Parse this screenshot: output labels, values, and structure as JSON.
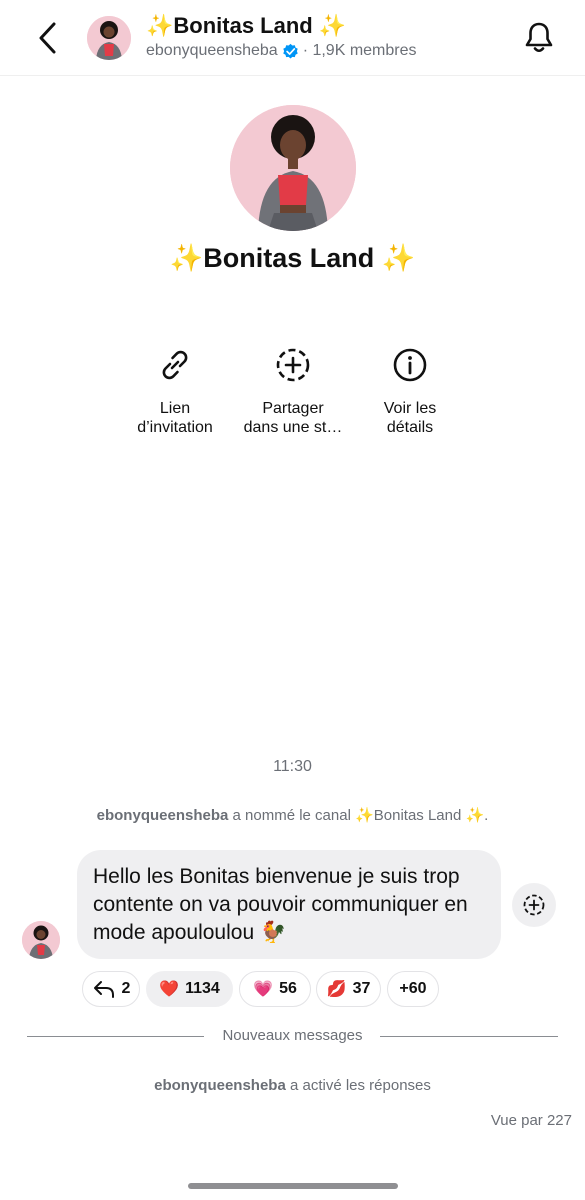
{
  "header": {
    "title": "✨Bonitas Land ✨",
    "owner": "ebonyqueensheba",
    "members": "· 1,9K membres"
  },
  "profile": {
    "name": "✨Bonitas Land ✨"
  },
  "actions": [
    {
      "label": "Lien\nd’invitation",
      "icon": "link-icon"
    },
    {
      "label": "Partager\ndans une st…",
      "icon": "add-story-icon"
    },
    {
      "label": "Voir les\ndétails",
      "icon": "info-icon"
    }
  ],
  "chat": {
    "time": "11:30",
    "system1_user": "ebonyqueensheba",
    "system1_text": " a nommé le canal ✨Bonitas Land ✨.",
    "message": "Hello les Bonitas bienvenue je suis trop contente on va pouvoir communiquer en mode apouloulou 🐓",
    "reactions": [
      {
        "emoji": "↩",
        "count": "2"
      },
      {
        "emoji": "❤️",
        "count": "1134"
      },
      {
        "emoji": "💗",
        "count": "56"
      },
      {
        "emoji": "💋",
        "count": "37"
      },
      {
        "emoji": "",
        "count": "+60"
      }
    ],
    "new_messages": "Nouveaux messages",
    "system2_user": "ebonyqueensheba",
    "system2_text": " a activé les réponses",
    "seen_by": "Vue par 227"
  },
  "colors": {
    "verified": "#0095f6",
    "bubble": "#efeff1",
    "muted": "#6b6f76"
  }
}
